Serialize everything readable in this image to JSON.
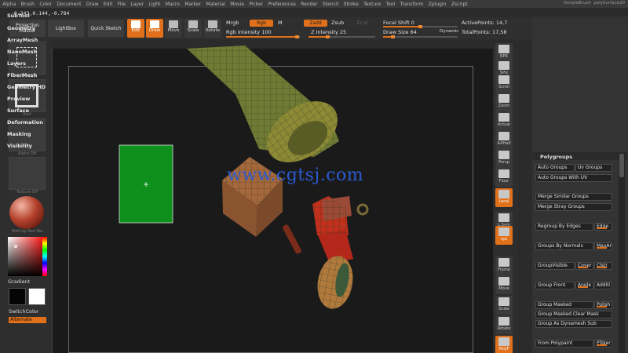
{
  "menu": [
    "Alpha",
    "Brush",
    "Color",
    "Document",
    "Draw",
    "Edit",
    "File",
    "Layer",
    "Light",
    "Macro",
    "Marker",
    "Material",
    "Movie",
    "Picker",
    "Preferences",
    "Render",
    "Stencil",
    "Stroke",
    "Texture",
    "Tool",
    "Transform",
    "Zplugin",
    "Zscript"
  ],
  "coords": "-0.343,0.144,-0.784",
  "top_right": {
    "simple_brush": "SimpleBrush",
    "poly_surface": "polySurface20"
  },
  "shelf": {
    "projection_master": "Projection Master",
    "lightbox": "LightBox",
    "quick_sketch": "Quick Sketch",
    "edit": "Edit",
    "draw": "Draw",
    "move": "Move",
    "scale": "Scale",
    "rotate": "Rotate",
    "mrgb": "Mrgb",
    "rgb": "Rgb",
    "m": "M",
    "rgb_intensity": "Rgb Intensity 100",
    "zadd": "Zadd",
    "zsub": "Zsub",
    "zcut": "Zcut",
    "z_intensity": "Z Intensity 25",
    "focal_shift": "Focal Shift 0",
    "draw_size": "Draw Size 64",
    "dynamic": "Dynamic",
    "active_points": "ActivePoints: 14,7",
    "total_points": "TotalPoints: 17,58"
  },
  "left_tray": {
    "select_rect": "SelectRect",
    "rect": "Rect",
    "alpha_off": "Alpha Off",
    "texture_off": "Texture Off",
    "matcap": "MatCap Red Wa",
    "gradient": "Gradient",
    "switch_color": "SwitchColor",
    "alternate": "Alternate"
  },
  "watermark": "www.cgtsj.com",
  "right_strip": [
    {
      "name": "bpr",
      "label": "BPR"
    },
    {
      "name": "spix",
      "label": "SPix"
    },
    {
      "name": "scroll",
      "label": "Scroll"
    },
    {
      "name": "zoom",
      "label": "Zoom"
    },
    {
      "name": "actual",
      "label": "Actual"
    },
    {
      "name": "aahalf",
      "label": "AAHalf"
    },
    {
      "name": "persp",
      "label": "Persp"
    },
    {
      "name": "floor",
      "label": "Floor"
    },
    {
      "name": "local",
      "label": "Local"
    },
    {
      "name": "lsym",
      "label": "L.Sym"
    },
    {
      "name": "xyz",
      "label": "xyz"
    },
    {
      "name": "frame",
      "label": "Frame"
    },
    {
      "name": "move",
      "label": "Move"
    },
    {
      "name": "scale",
      "label": "Scale"
    },
    {
      "name": "rotate",
      "label": "Rotate"
    },
    {
      "name": "polyf",
      "label": "PolyF"
    }
  ],
  "right_panel": {
    "subtool": "SubTool",
    "geometry": "Geometry",
    "arraymesh": "ArrayMesh",
    "nanomesh": "NanoMesh",
    "layers": "Layers",
    "fibermesh": "FiberMesh",
    "geometry_hd": "Geometry HD",
    "preview": "Preview",
    "surface": "Surface",
    "deformation": "Deformation",
    "masking": "Masking",
    "visibility": "Visibility",
    "polygroups": "Polygroups",
    "auto_groups": "Auto Groups",
    "uv_groups": "Uv Groups",
    "auto_groups_uv": "Auto Groups With UV",
    "merge_similar": "Merge Similar Groups",
    "merge_stray": "Merge Stray Groups",
    "regroup_edges": "Regroup By Edges",
    "edge": "Edge",
    "groups_normals": "Groups By Normals",
    "maxar": "MaxAr",
    "group_visible": "GroupVisible",
    "cover": "Cover",
    "clstr": "Clstr",
    "group_front": "Group Front",
    "angle": "Angle",
    "additi": "Additi",
    "group_masked": "Group Masked",
    "polish": "Polish",
    "group_masked_clear": "Group Masked Clear Mask",
    "group_dynamesh": "Group As Dynamesh Sub",
    "from_polypaint": "From Polypaint",
    "ptoler": "PToler"
  },
  "colors": {
    "accent": "#e0701a",
    "green_rect": "#0f8f1c",
    "watermark": "#2a5bd0"
  }
}
